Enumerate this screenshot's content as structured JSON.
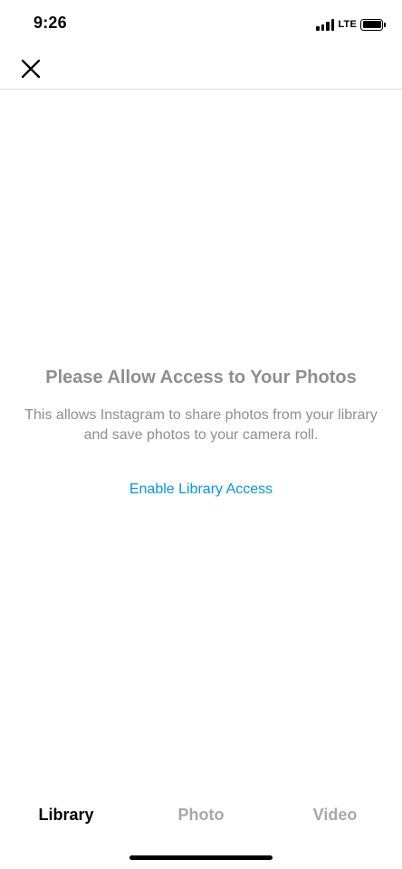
{
  "status_bar": {
    "time": "9:26",
    "network": "LTE",
    "signal_icon": "cellular-signal-icon",
    "battery_icon": "battery-icon"
  },
  "header": {
    "close_icon": "close-icon"
  },
  "empty_state": {
    "title": "Please Allow Access to Your Photos",
    "description": "This allows Instagram to share photos from your library and save photos to your camera roll.",
    "action_label": "Enable Library Access"
  },
  "tabs": [
    {
      "label": "Library",
      "active": true
    },
    {
      "label": "Photo",
      "active": false
    },
    {
      "label": "Video",
      "active": false
    }
  ],
  "colors": {
    "link": "#0095f6",
    "muted_text": "#8e8e8e",
    "inactive_tab": "#a8a8a8",
    "divider": "#dbdbdb"
  }
}
